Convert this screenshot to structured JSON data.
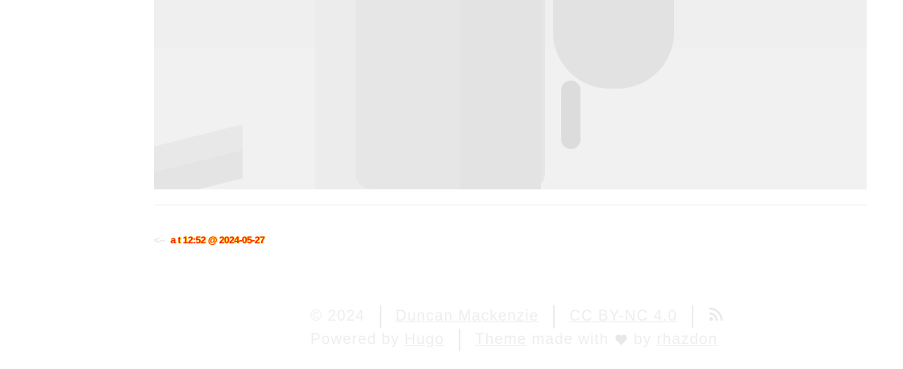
{
  "post": {
    "image": {
      "description": ""
    }
  },
  "post_nav": {
    "prev_arrow": "<--",
    "prev_label": "a t 12:52 @ 2024-05-27"
  },
  "footer": {
    "copyright": "© 2024",
    "author_link": "Duncan Mackenzie",
    "license_link": "CC BY-NC 4.0",
    "rss_icon": "rss-icon",
    "powered_by": "Powered by",
    "hugo_link": "Hugo",
    "theme_link": "Theme",
    "made_with": "made with",
    "by": "by",
    "rhazdon_link": "rhazdon"
  },
  "colors": {
    "footer_text": "#eeeeee",
    "post_nav_link": "#ff2200",
    "post_nav_glow": "#ffd400",
    "photo_bg": "#efefef"
  }
}
